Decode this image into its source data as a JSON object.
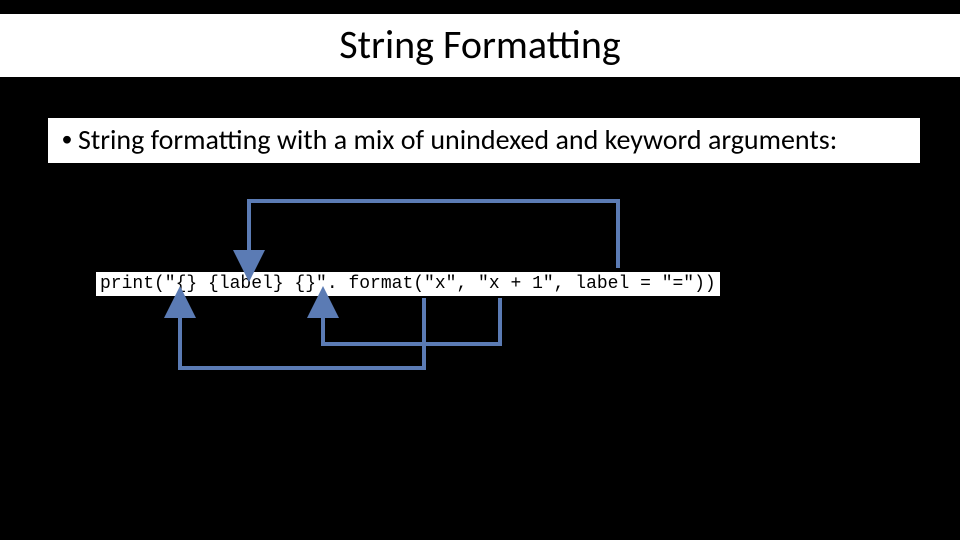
{
  "title": "String Formatting",
  "bullet": {
    "dot": "•",
    "text": "String formatting with a mix of unindexed and keyword arguments:"
  },
  "code": "print(\"{} {label} {}\". format(\"x\", \"x + 1\", label = \"=\"))",
  "arrows": {
    "color": "#5B7BB4",
    "stroke_width": 4
  }
}
